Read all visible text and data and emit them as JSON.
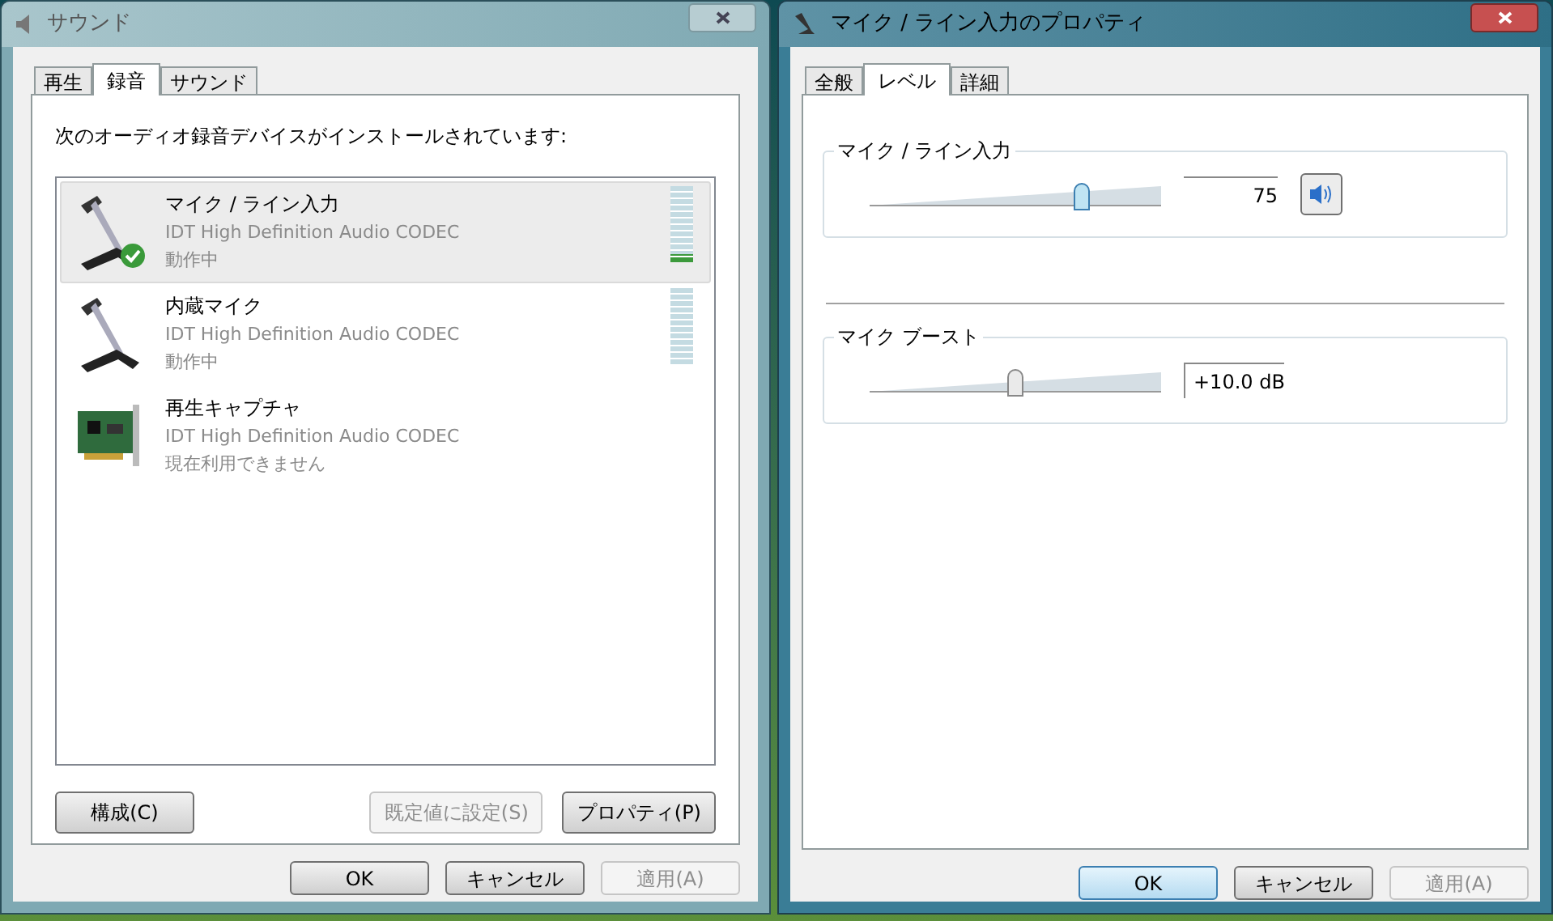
{
  "sound_window": {
    "title": "サウンド",
    "active": false,
    "tabs": [
      {
        "label": "再生",
        "selected": false
      },
      {
        "label": "録音",
        "selected": true
      },
      {
        "label": "サウンド",
        "selected": false
      }
    ],
    "description": "次のオーディオ録音デバイスがインストールされています:",
    "devices": [
      {
        "kind": "microphone",
        "name": "マイク / ライン入力",
        "driver": "IDT High Definition Audio CODEC",
        "status": "動作中",
        "selected": true,
        "default": true,
        "level": 0.1
      },
      {
        "kind": "microphone",
        "name": "内蔵マイク",
        "driver": "IDT High Definition Audio CODEC",
        "status": "動作中",
        "selected": false,
        "default": false,
        "level": 0
      },
      {
        "kind": "card",
        "name": "再生キャプチャ",
        "driver": "IDT High Definition Audio CODEC",
        "status": "現在利用できません",
        "selected": false,
        "default": false
      }
    ],
    "panel_buttons": [
      {
        "label": "構成(C)",
        "disabled": false
      },
      {
        "label": "既定値に設定(S)",
        "disabled": true
      },
      {
        "label": "プロパティ(P)",
        "disabled": false
      }
    ],
    "dialog_buttons": [
      {
        "label": "OK",
        "disabled": false,
        "default": false
      },
      {
        "label": "キャンセル",
        "disabled": false,
        "default": false
      },
      {
        "label": "適用(A)",
        "disabled": true,
        "default": false
      }
    ]
  },
  "properties_window": {
    "title": "マイク / ライン入力のプロパティ",
    "active": true,
    "tabs": [
      {
        "label": "全般",
        "selected": false
      },
      {
        "label": "レベル",
        "selected": true
      },
      {
        "label": "詳細",
        "selected": false
      }
    ],
    "sliders": [
      {
        "kind": "volume",
        "label": "マイク / ライン入力",
        "level": 0.74,
        "reading": "75",
        "muted": false
      },
      {
        "kind": "boost",
        "label": "マイク ブースト",
        "level": 0.5,
        "reading": "+10.0 dB"
      }
    ],
    "dialog_buttons": [
      {
        "label": "OK",
        "disabled": false,
        "default": true
      },
      {
        "label": "キャンセル",
        "disabled": false,
        "default": false
      },
      {
        "label": "適用(A)",
        "disabled": true,
        "default": false
      }
    ]
  }
}
